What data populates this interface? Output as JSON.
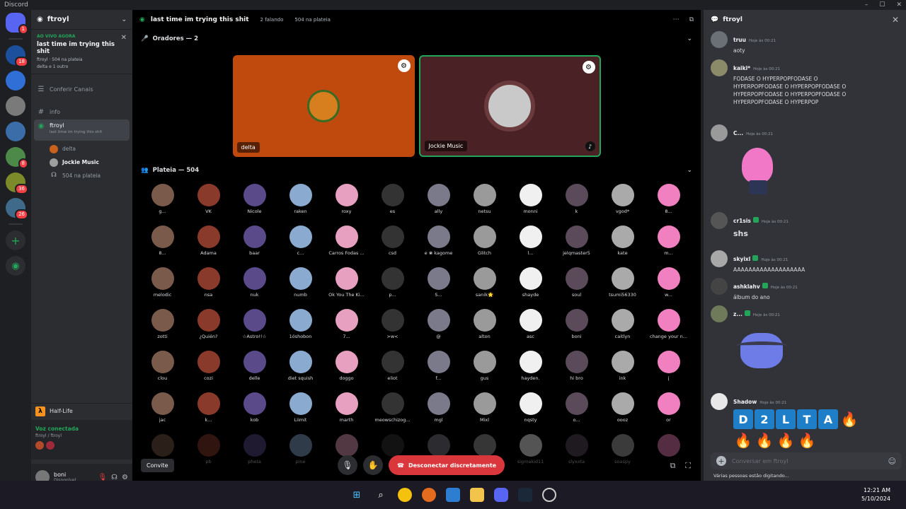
{
  "window": {
    "app_title": "Discord"
  },
  "rail": {
    "badges": [
      "1",
      "18",
      "8",
      "36",
      "26"
    ]
  },
  "server": {
    "name": "ftroyl"
  },
  "live": {
    "tag": "AO VIVO AGORA",
    "title": "last time im trying this shit",
    "meta": "ftroyl · 504 na plateia",
    "people": "delta e 1 outro"
  },
  "channels": {
    "browse": "Conferir Canais",
    "info": "info",
    "stage_name": "ftroyl",
    "stage_sub": "last time im trying this shit",
    "members": [
      {
        "name": "delta",
        "bold": false
      },
      {
        "name": "Jockie Music",
        "bold": true
      },
      {
        "name": "504 na plateia",
        "bold": false
      }
    ]
  },
  "game": {
    "name": "Half-Life"
  },
  "voice": {
    "status": "Voz conectada",
    "location": "ftroyl / ftroyl"
  },
  "user": {
    "name": "boni",
    "status": "Disponível"
  },
  "stage": {
    "title": "last time im trying this shit",
    "speaking": "2 falando",
    "audience_count": "504 na plateia",
    "speakers_header": "Oradores — 2",
    "audience_header": "Plateia — 504",
    "speakers": [
      {
        "name": "delta"
      },
      {
        "name": "Jockie Music"
      }
    ],
    "audience": [
      "g...",
      "VK",
      "Nicole",
      "raken",
      "roxy",
      "es",
      "ally",
      "netsu",
      "monni",
      "k",
      "vgod*",
      "8...",
      "8...",
      "Adama",
      "baar",
      "c...",
      "Carros Fodas ...",
      "csd",
      "e ❀ kagome",
      "Glitch",
      "l...",
      "jelqmaster5",
      "kate",
      "m...",
      "melodic",
      "nsa",
      "nuk",
      "numb",
      "Ok You The Ki...",
      "p...",
      "S...",
      "sanik🌟",
      "shayde",
      "soul",
      "tsumi56330",
      "w...",
      "zotti",
      "¿Quién?",
      "☆Astro!!☆",
      "1óshobon",
      "7...",
      ">w<",
      "@",
      "alton",
      "asc",
      "boni",
      "caitlyn",
      "change your n...",
      "clou",
      "cozi",
      "delle",
      "diet squish",
      "doggo",
      "eliot",
      "f...",
      "gus",
      "hayden.",
      "hi bro",
      "ink",
      "j",
      "jac",
      "k...",
      "kob",
      "Liimit",
      "marth",
      "meowschizog...",
      "mgl",
      "Mixl",
      "nqsty",
      "o...",
      "oooz",
      "or",
      "",
      "pb",
      "pheta",
      "pine",
      "",
      "",
      "",
      "",
      "sigmakid11",
      "slyxxta",
      "soaspy",
      ""
    ],
    "invite_label": "Convite",
    "leave_label": "Desconectar discretamente"
  },
  "chat": {
    "title": "ftroyl",
    "messages": [
      {
        "author": "truu",
        "time": "Hoje às 00:21",
        "text": "aoty"
      },
      {
        "author": "kaiki*",
        "time": "Hoje às 00:21",
        "text": "FODASE O HYPERPOPFODASE O HYPERPOPFODASE O HYPERPOPFODASE O HYPERPOPFODASE O HYPERPOPFODASE O HYPERPOPFODASE O HYPERPOP"
      },
      {
        "author": "C...",
        "time": "Hoje às 00:21",
        "text": ""
      },
      {
        "author": "cr1sis",
        "time": "Hoje às 00:21",
        "text": "shs"
      },
      {
        "author": "skyixl",
        "time": "Hoje às 00:21",
        "text": "AAAAAAAAAAAAAAAAAAA"
      },
      {
        "author": "ashklahv",
        "time": "Hoje às 00:21",
        "text": "álbum do ano"
      },
      {
        "author": "z...",
        "time": "Hoje às 00:21",
        "text": ""
      },
      {
        "author": "Shadow",
        "time": "Hoje às 00:21",
        "text": ""
      }
    ],
    "shadow_letters": [
      "D",
      "2",
      "L",
      "T",
      "A"
    ],
    "composer_placeholder": "Conversar em ftroyl",
    "typing": "Várias pessoas estão digitando..."
  },
  "taskbar": {
    "time": "12:21 AM",
    "date": "5/10/2024"
  },
  "colors": {
    "accent": "#5865f2",
    "online": "#23a559",
    "danger": "#da373c",
    "speaker_delta": "#c0490e",
    "speaker_jockie": "#4a2225"
  }
}
